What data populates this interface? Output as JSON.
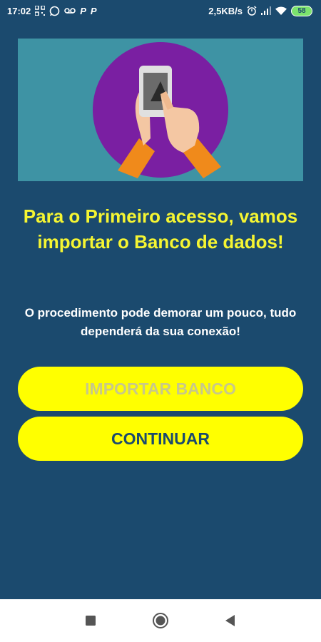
{
  "status_bar": {
    "time": "17:02",
    "network_speed": "2,5KB/s",
    "battery_level": "58",
    "icons": [
      "qr-icon",
      "whatsapp-icon",
      "voicemail-icon",
      "p-app-icon",
      "p-app-icon",
      "alarm-icon",
      "signal-icon",
      "wifi-icon",
      "battery-icon"
    ],
    "p_app_glyph": "P"
  },
  "hero": {
    "illustration": "hand-touching-phone",
    "background_color": "#3e93a4",
    "circle_color": "#7a1fa2"
  },
  "main": {
    "title": "Para o Primeiro acesso, vamos importar o Banco de dados!",
    "subtitle": "O procedimento pode demorar um pouco, tudo dependerá da sua conexão!"
  },
  "buttons": {
    "import_label": "IMPORTAR BANCO",
    "continue_label": "CONTINUAR"
  },
  "colors": {
    "background": "#1b4a6e",
    "title": "#f5f532",
    "button_bg": "#ffff00",
    "import_disabled_text": "#c8c88a",
    "continue_text": "#1b4a6e"
  },
  "nav_bar": {
    "icons": [
      "recents-square-icon",
      "home-circle-icon",
      "back-triangle-icon"
    ]
  }
}
